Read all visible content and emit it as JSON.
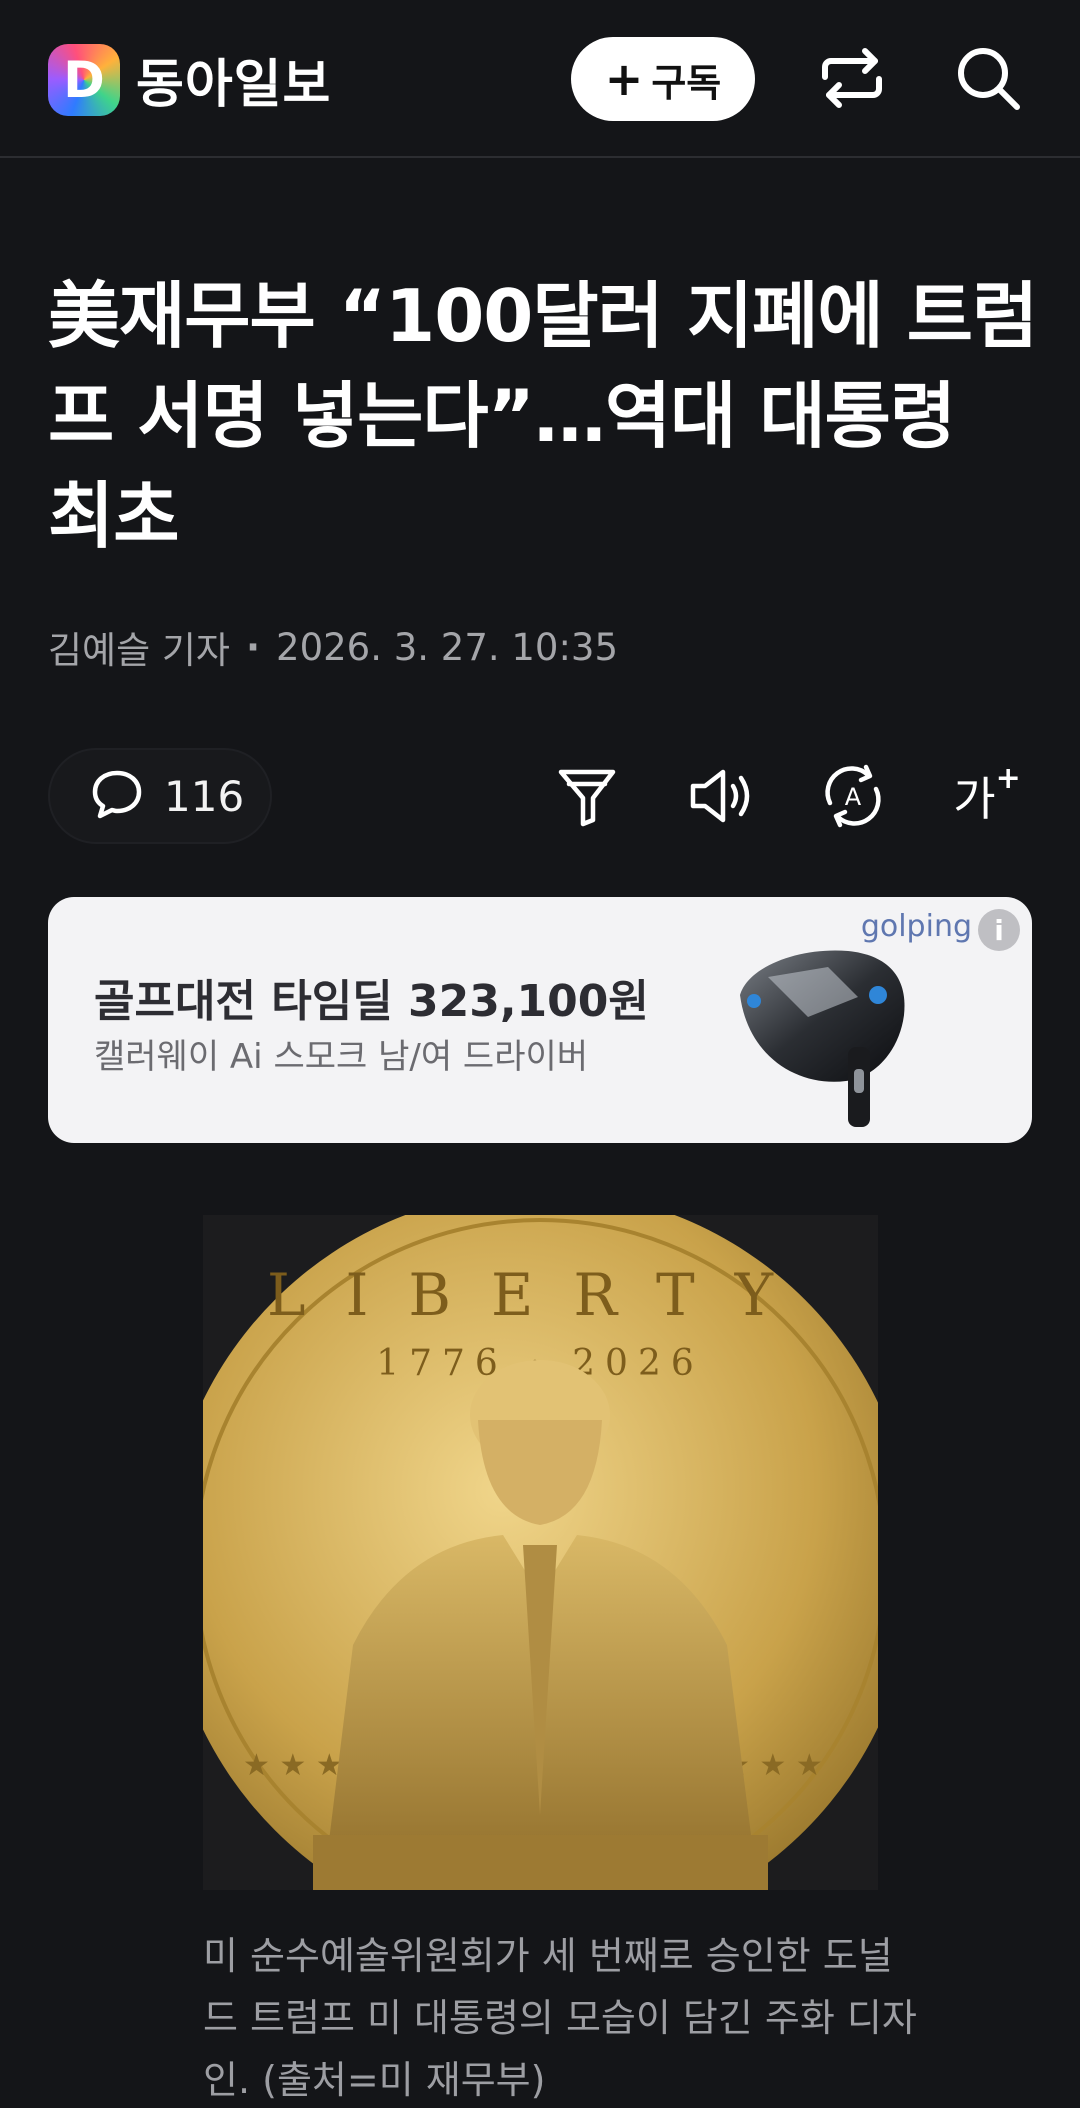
{
  "header": {
    "logo_letter": "D",
    "logo_text": "동아일보",
    "subscribe_plus": "+",
    "subscribe_label": "구독",
    "share_icon": "share-arrow-icon",
    "search_icon": "search-icon"
  },
  "article": {
    "title": "美재무부 “100달러 지폐에 트럼프 서명 넣는다”…역대 대통령 최초",
    "author": "김예슬 기자",
    "dot": "·",
    "datetime": "2026. 3. 27. 10:35"
  },
  "toolbar": {
    "comment_count": "116",
    "icons": [
      "comment-icon",
      "filter-icon",
      "speaker-icon",
      "translate-icon",
      "font-size-icon"
    ],
    "font_size_label": "가",
    "font_size_plus": "+",
    "translate_letter": "A"
  },
  "ad": {
    "brand": "golping",
    "info": "i",
    "title": "골프대전 타임딜 323,100원",
    "subtitle": "캘러웨이 Ai 스모크 남/여 드라이버"
  },
  "photo": {
    "coin_letters": "LIBERTY",
    "coin_years": "1776 · 2026",
    "caption": "미 순수예술위원회가 세 번째로 승인한 도널드 트럼프 미 대통령의 모습이 담긴 주화 디자인. (출처=미 재무부)"
  },
  "colors": {
    "background": "#141518",
    "subscribe_bg": "#ffffff",
    "ad_bg": "#f3f3f5",
    "coin_gold": "#c9a24a"
  }
}
